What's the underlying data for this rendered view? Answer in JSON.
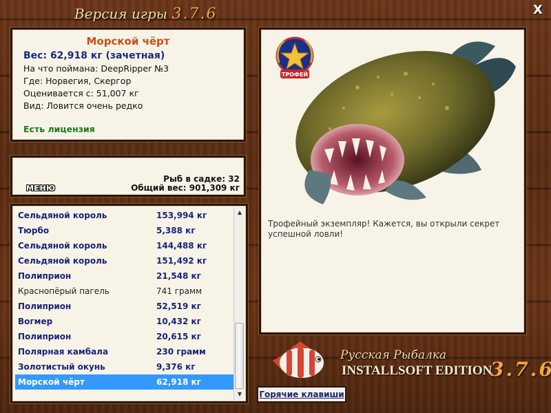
{
  "window": {
    "title_prefix": "Версия игры",
    "title_version": "3.7.6",
    "close_glyph": "X"
  },
  "fish_info": {
    "name": "Морской чёрт",
    "weight": "Вес: 62,918 кг (зачетная)",
    "caught_with": "На что поймана: DeepRipper №3",
    "location": "Где: Норвегия, Скергор",
    "rated_from": "Оценивается с: 51,007 кг",
    "kind": "Вид: Ловится очень редко",
    "license": "Есть лицензия"
  },
  "keepnet": {
    "menu_label": "МЕНЮ",
    "fish_count": "Рыб в садке: 32",
    "total_weight": "Общий вес: 901,309 кг"
  },
  "catch_list": [
    {
      "name": "Сельдяной король",
      "weight": "153,994 кг",
      "style": "bold"
    },
    {
      "name": "Тюрбо",
      "weight": "5,388 кг",
      "style": "bold"
    },
    {
      "name": "Сельдяной король",
      "weight": "144,488 кг",
      "style": "bold"
    },
    {
      "name": "Сельдяной король",
      "weight": "151,492 кг",
      "style": "bold"
    },
    {
      "name": "Полиприон",
      "weight": "21,548 кг",
      "style": "bold"
    },
    {
      "name": "Краснопёрый пагель",
      "weight": "741 грамм",
      "style": "plain"
    },
    {
      "name": "Полиприон",
      "weight": "52,519 кг",
      "style": "bold"
    },
    {
      "name": "Вогмер",
      "weight": "10,432 кг",
      "style": "bold"
    },
    {
      "name": "Полиприон",
      "weight": "20,615 кг",
      "style": "bold"
    },
    {
      "name": "Полярная камбала",
      "weight": "230 грамм",
      "style": "bold"
    },
    {
      "name": "Золотистый окунь",
      "weight": "9,376 кг",
      "style": "bold"
    },
    {
      "name": "Морской чёрт",
      "weight": "62,918 кг",
      "style": "sel"
    }
  ],
  "trophy": {
    "medal_label": "ТРОФЕЙ",
    "description": "Трофейный экземпляр! Кажется, вы открыли секрет успешной ловли!"
  },
  "branding": {
    "line1": "Русская Рыбалка",
    "line2": "INSTALLSOFT EDITION",
    "version": "3.7.6"
  },
  "hotkeys_label": "Горячие клавиши",
  "colors": {
    "accent_orange": "#c8501a",
    "list_text_blue": "#1a237a",
    "selection_blue": "#3399ff",
    "license_green": "#1a7a1a",
    "version_orange": "#f0a640"
  }
}
